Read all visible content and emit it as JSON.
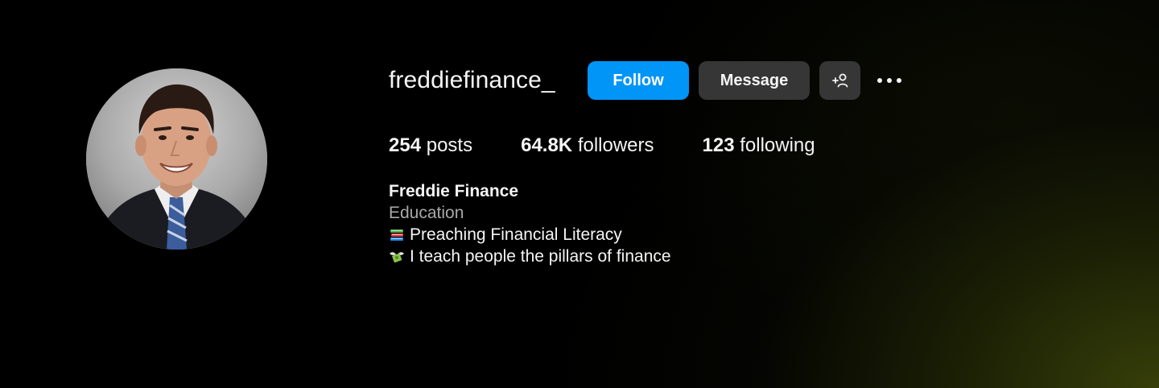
{
  "profile": {
    "username": "freddiefinance_",
    "display_name": "Freddie Finance",
    "category": "Education",
    "avatar_icon": "profile-photo"
  },
  "actions": {
    "follow_label": "Follow",
    "message_label": "Message",
    "suggest_icon": "add-person-icon",
    "more_icon": "more-options-icon"
  },
  "stats": {
    "posts_count": "254",
    "posts_label": "posts",
    "followers_count": "64.8K",
    "followers_label": "followers",
    "following_count": "123",
    "following_label": "following"
  },
  "bio": {
    "lines": [
      {
        "icon": "books-emoji",
        "text": "Preaching Financial Literacy"
      },
      {
        "icon": "money-wings-emoji",
        "text": "I teach people the pillars of finance"
      }
    ]
  },
  "colors": {
    "follow_button": "#0095f6",
    "secondary_button": "#363636",
    "category_text": "#a8a8a8",
    "background": "#000000",
    "corner_glow": "#3a420a"
  }
}
